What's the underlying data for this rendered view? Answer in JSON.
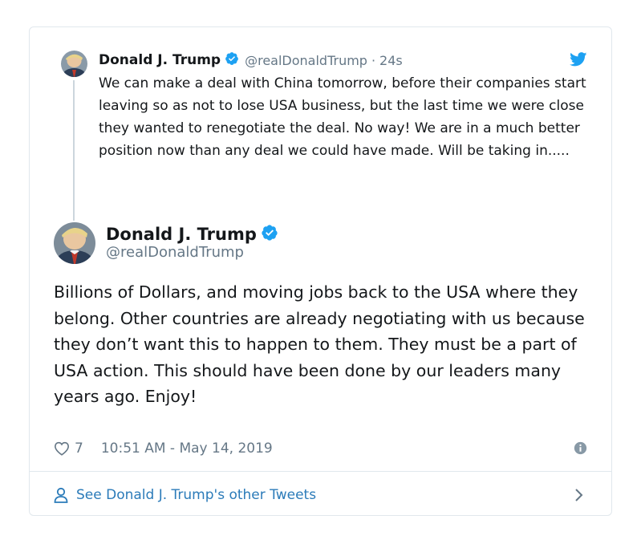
{
  "quoted_tweet": {
    "display_name": "Donald J. Trump",
    "handle": "@realDonaldTrump",
    "separator": "·",
    "time_ago": "24s",
    "text": "We can make a deal with China tomorrow, before their companies start leaving so as not to lose USA business, but the last time we were close they wanted to renegotiate the deal. No way! We are in a much better position now than any deal we could have made. Will be taking in....."
  },
  "tweet": {
    "display_name": "Donald J. Trump",
    "handle": "@realDonaldTrump",
    "text": "Billions of Dollars, and moving jobs back to the USA where they belong. Other countries are already negotiating with us because they don’t want this to happen to them. They must be a part of USA action. This should have been done by our leaders many years ago. Enjoy!",
    "like_count": "7",
    "timestamp": "10:51 AM - May 14, 2019"
  },
  "footer": {
    "link_label": "See Donald J. Trump's other Tweets"
  },
  "icons": {
    "verified": "verified-badge-icon",
    "bird": "twitter-bird-icon",
    "heart": "heart-icon",
    "info": "info-icon",
    "person": "person-icon",
    "chevron": "chevron-right-icon"
  },
  "colors": {
    "brand_blue": "#1da1f2",
    "link_blue": "#2b7bb9",
    "muted": "#657786",
    "border": "#e1e8ed"
  }
}
